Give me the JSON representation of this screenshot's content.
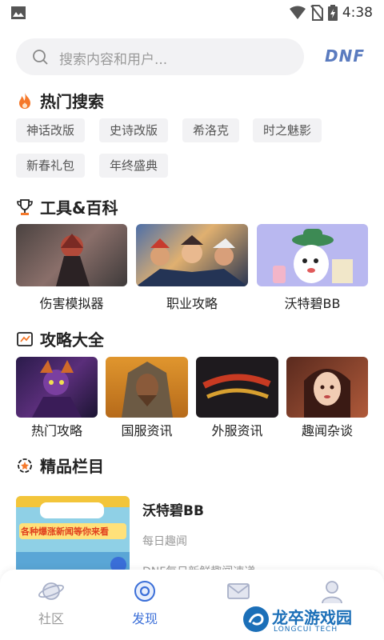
{
  "status_bar": {
    "time": "4:38"
  },
  "search": {
    "placeholder": "搜索内容和用户...",
    "brand": "DNF"
  },
  "hot_search": {
    "title": "热门搜索",
    "tags": [
      "神话改版",
      "史诗改版",
      "希洛克",
      "时之魅影",
      "新春礼包",
      "年终盛典"
    ]
  },
  "tools": {
    "title": "工具&百科",
    "items": [
      {
        "label": "伤害模拟器"
      },
      {
        "label": "职业攻略"
      },
      {
        "label": "沃特碧BB"
      }
    ]
  },
  "guides": {
    "title": "攻略大全",
    "items": [
      {
        "label": "热门攻略"
      },
      {
        "label": "国服资讯"
      },
      {
        "label": "外服资讯"
      },
      {
        "label": "趣闻杂谈"
      }
    ]
  },
  "featured": {
    "title": "精品栏目",
    "item": {
      "name": "沃特碧BB",
      "subtitle": "每日趣闻",
      "desc": "DNF每日新鲜趣闻速递",
      "banner_text": "各种爆涨新闻等你来看"
    }
  },
  "bottom_nav": {
    "items": [
      {
        "label": "社区",
        "active": false
      },
      {
        "label": "发现",
        "active": true
      },
      {
        "label": "消息",
        "active": false
      },
      {
        "label": "我的",
        "active": false
      }
    ]
  },
  "watermark": {
    "text": "龙卒游戏园",
    "sub": "LONGCUI TECH"
  },
  "colors": {
    "active": "#3b6fd8",
    "inactive": "#999999",
    "fire": "#f5782a"
  }
}
